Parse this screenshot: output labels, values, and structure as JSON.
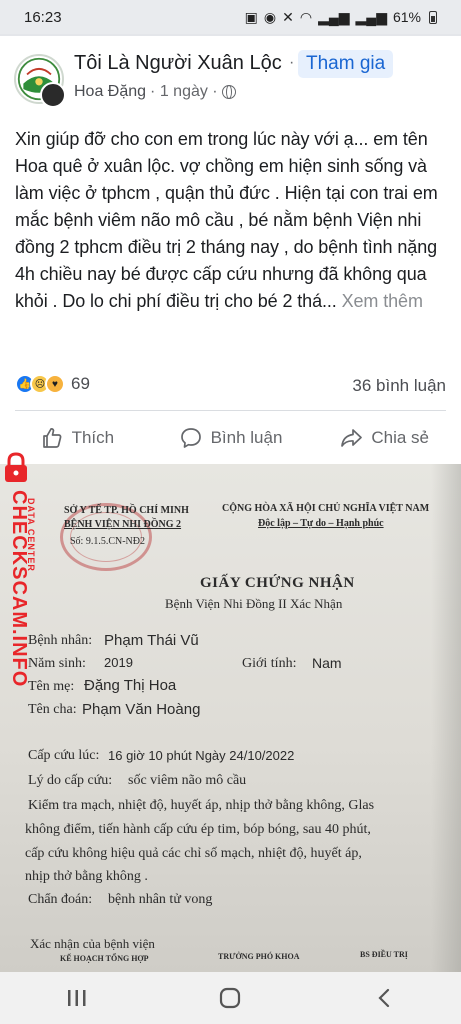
{
  "status_bar": {
    "time": "16:23",
    "battery": "61%"
  },
  "post": {
    "group_name": "Tôi Là Người Xuân Lộc",
    "dot": "·",
    "join_label": "Tham gia",
    "author": "Hoa Đặng",
    "time_ago": "· 1 ngày ·",
    "text": "Xin giúp đỡ cho con em trong lúc này với ạ... em tên Hoa quê ở xuân lộc. vợ chồng em hiện sinh sống và làm việc ở tphcm , quận thủ đức . Hiện tại con trai em mắc bệnh viêm não mô cầu , bé nằm bệnh Viện nhi đồng 2 tphcm điều trị 2 tháng nay , do bệnh tình nặng 4h chiều nay bé được cấp cứu nhưng đã không qua khỏi . Do lo chi phí điều trị cho bé 2 thá...",
    "see_more": "Xem thêm",
    "reaction_count": "69",
    "comment_count": "36 bình luận",
    "actions": {
      "like": "Thích",
      "comment": "Bình luận",
      "share": "Chia sẻ"
    }
  },
  "document": {
    "left_header_1": "SỞ Y TẾ TP. HỒ CHÍ MINH",
    "left_header_2": "BỆNH VIỆN NHI ĐỒNG 2",
    "left_header_3": "Số: 9.1.5.CN-NĐ2",
    "right_header_1": "CỘNG HÒA XÃ HỘI CHỦ NGHĨA VIỆT NAM",
    "right_header_2": "Độc lập – Tự do – Hạnh phúc",
    "title": "GIẤY CHỨNG NHẬN",
    "subtitle": "Bệnh Viện Nhi Đồng II Xác Nhận",
    "patient_label": "Bệnh nhân:",
    "patient_value": "Phạm Thái Vũ",
    "birth_label": "Năm sinh:",
    "birth_value": "2019",
    "gender_label": "Giới tính:",
    "gender_value": "Nam",
    "mother_label": "Tên mẹ:",
    "mother_value": "Đặng Thị Hoa",
    "father_label": "Tên cha:",
    "father_value": "Phạm Văn Hoàng",
    "emergency_label": "Cấp cứu lúc:",
    "emergency_value": "16 giờ 10 phút Ngày 24/10/2022",
    "reason_label": "Lý do cấp cứu:",
    "reason_value": "sốc viêm não mô cầu",
    "exam_line_1": "Kiểm tra mạch, nhiệt độ, huyết áp, nhịp thở bằng không, Glas",
    "exam_line_2": "không điểm, tiến hành cấp cứu ép tim, bóp bóng, sau 40 phút,",
    "exam_line_3": "cấp cứu không hiệu quả các chỉ số mạch, nhiệt độ, huyết áp,",
    "exam_line_4": "nhịp thở bằng không .",
    "diagnosis_label": "Chẩn đoán:",
    "diagnosis_value": "bệnh nhân tử vong",
    "confirm_label": "Xác nhận của bệnh viện",
    "footer_left": "KẾ HOẠCH TỔNG HỢP",
    "footer_mid": "TRƯỞNG PHÓ KHOA",
    "footer_right": "BS ĐIỀU TRỊ"
  },
  "watermark": {
    "main": "CHECKSCAM.INFO",
    "sub": "DATA CENTER"
  }
}
